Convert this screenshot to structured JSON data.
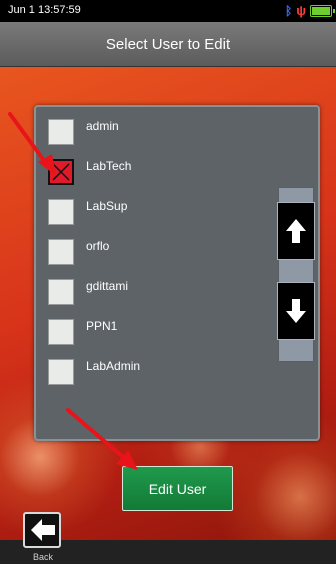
{
  "status_bar": {
    "time": "Jun 1 13:57:59",
    "icons": [
      "bluetooth-icon",
      "usb-icon",
      "battery-icon"
    ],
    "battery_label": "100"
  },
  "header": {
    "title": "Select User to Edit"
  },
  "users": [
    {
      "name": "admin",
      "checked": false
    },
    {
      "name": "LabTech",
      "checked": true
    },
    {
      "name": "LabSup",
      "checked": false
    },
    {
      "name": "orflo",
      "checked": false
    },
    {
      "name": "gdittami",
      "checked": false
    },
    {
      "name": "PPN1",
      "checked": false
    },
    {
      "name": "LabAdmin",
      "checked": false
    }
  ],
  "scroll": {
    "up_icon": "arrow-up-icon",
    "down_icon": "arrow-down-icon"
  },
  "actions": {
    "edit_label": "Edit User",
    "back_label": "Back"
  },
  "colors": {
    "accent_green": "#1a8a44",
    "checked_red": "#e01a2a",
    "annotation_red": "#e8141a",
    "panel_gray": "#5d6367"
  }
}
